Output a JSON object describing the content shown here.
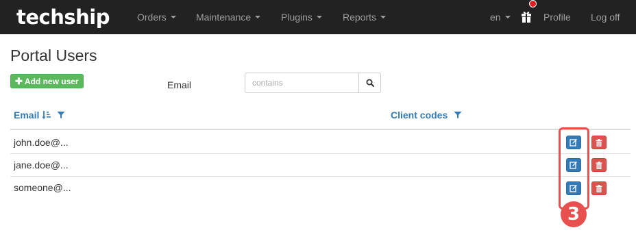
{
  "navbar": {
    "brand": "techship",
    "menus": [
      {
        "label": "Orders"
      },
      {
        "label": "Maintenance"
      },
      {
        "label": "Plugins"
      },
      {
        "label": "Reports"
      }
    ],
    "language": "en",
    "profile_label": "Profile",
    "logoff_label": "Log off"
  },
  "page": {
    "title": "Portal Users",
    "add_button_label": "Add new user"
  },
  "filter": {
    "label": "Email",
    "placeholder": "contains",
    "value": ""
  },
  "table": {
    "columns": [
      "Email",
      "Client codes"
    ],
    "rows": [
      {
        "email": "john.doe@...",
        "client_codes": ""
      },
      {
        "email": "jane.doe@...",
        "client_codes": ""
      },
      {
        "email": "someone@...",
        "client_codes": ""
      }
    ]
  },
  "annotation": {
    "badge": "3"
  },
  "colors": {
    "navbar_bg": "#222222",
    "nav_text": "#9d9d9d",
    "link_blue": "#337ab7",
    "success_green": "#5cb85c",
    "danger_red": "#d9534f",
    "annotation_red": "#e8504f"
  },
  "icons": {
    "gift": "gift-icon",
    "search": "search-icon",
    "sort": "sort-amount-asc-icon",
    "filter": "filter-icon",
    "edit": "edit-icon",
    "delete": "trash-icon"
  }
}
